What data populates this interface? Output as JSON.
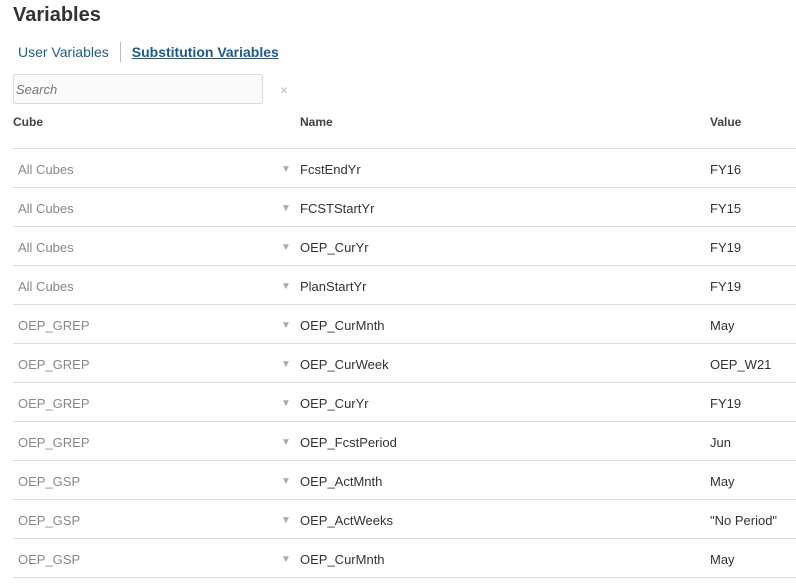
{
  "title": "Variables",
  "tabs": {
    "user": "User Variables",
    "substitution": "Substitution Variables"
  },
  "search": {
    "placeholder": "Search",
    "clear_icon": "×"
  },
  "columns": {
    "cube": "Cube",
    "name": "Name",
    "value": "Value"
  },
  "rows": [
    {
      "cube": "All Cubes",
      "name": "FcstEndYr",
      "value": "FY16"
    },
    {
      "cube": "All Cubes",
      "name": "FCSTStartYr",
      "value": "FY15"
    },
    {
      "cube": "All Cubes",
      "name": "OEP_CurYr",
      "value": "FY19"
    },
    {
      "cube": "All Cubes",
      "name": "PlanStartYr",
      "value": "FY19"
    },
    {
      "cube": "OEP_GREP",
      "name": "OEP_CurMnth",
      "value": "May"
    },
    {
      "cube": "OEP_GREP",
      "name": "OEP_CurWeek",
      "value": "OEP_W21"
    },
    {
      "cube": "OEP_GREP",
      "name": "OEP_CurYr",
      "value": "FY19"
    },
    {
      "cube": "OEP_GREP",
      "name": "OEP_FcstPeriod",
      "value": "Jun"
    },
    {
      "cube": "OEP_GSP",
      "name": "OEP_ActMnth",
      "value": "May"
    },
    {
      "cube": "OEP_GSP",
      "name": "OEP_ActWeeks",
      "value": "\"No Period\""
    },
    {
      "cube": "OEP_GSP",
      "name": "OEP_CurMnth",
      "value": "May"
    }
  ]
}
